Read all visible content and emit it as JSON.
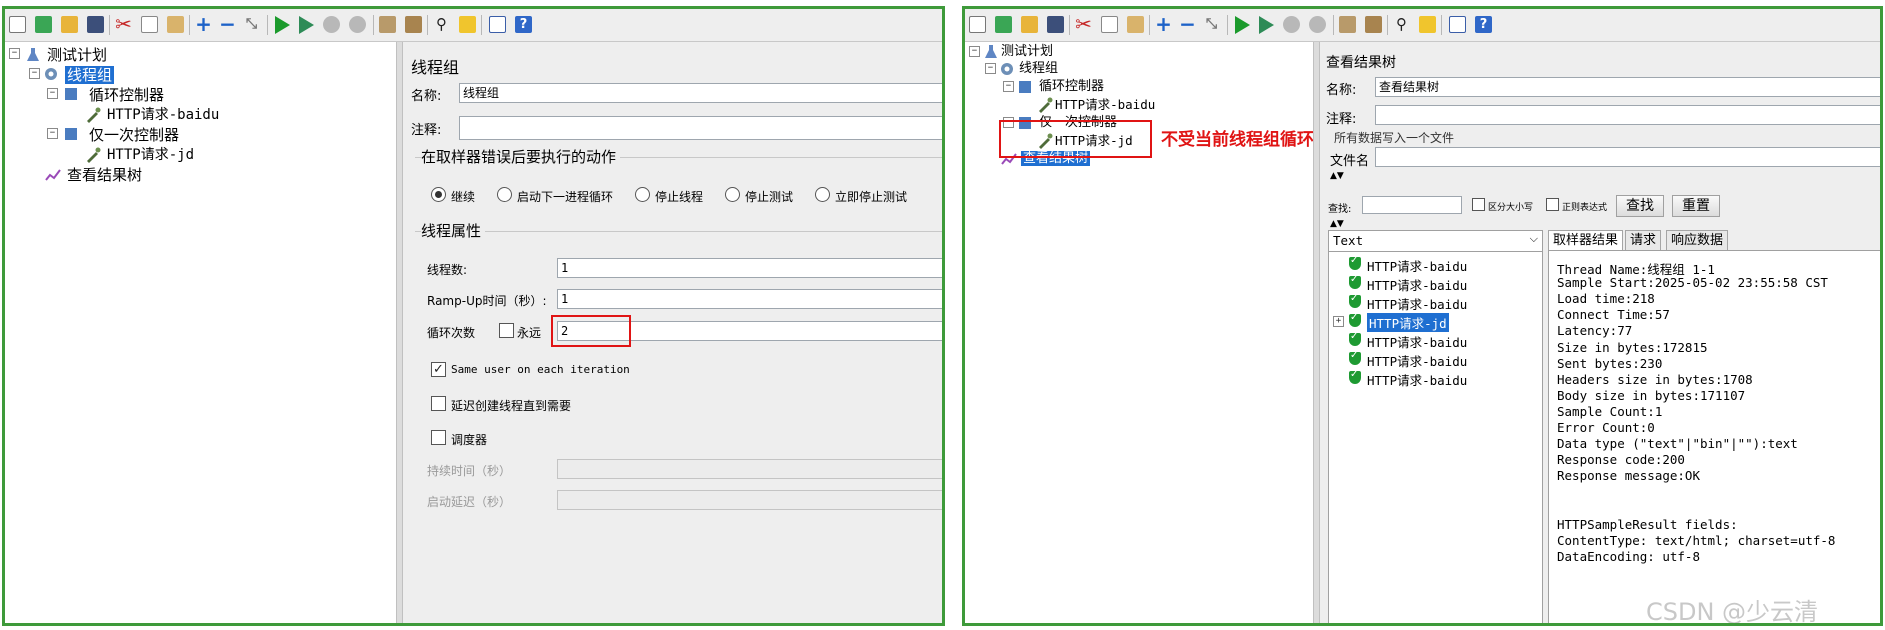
{
  "left": {
    "tree": {
      "root": "测试计划",
      "thread_group": "线程组",
      "loop_controller": "循环控制器",
      "http_baidu": "HTTP请求-baidu",
      "once_controller": "仅一次控制器",
      "http_jd": "HTTP请求-jd",
      "results_tree": "查看结果树"
    },
    "form": {
      "title": "线程组",
      "name_label": "名称:",
      "name_value": "线程组",
      "comment_label": "注释:",
      "error_section": "在取样器错误后要执行的动作",
      "radio_continue": "继续",
      "radio_next_loop": "启动下一进程循环",
      "radio_stop_thread": "停止线程",
      "radio_stop_test": "停止测试",
      "radio_stop_now": "立即停止测试",
      "props_section": "线程属性",
      "threads_label": "线程数:",
      "threads_value": "1",
      "rampup_label": "Ramp-Up时间（秒）:",
      "rampup_value": "1",
      "loop_label": "循环次数",
      "forever_label": "永远",
      "loop_value": "2",
      "same_user_label": "Same user on each iteration",
      "delay_create_label": "延迟创建线程直到需要",
      "scheduler_label": "调度器",
      "duration_label": "持续时间（秒）",
      "startup_delay_label": "启动延迟（秒）"
    }
  },
  "right": {
    "tree": {
      "root": "测试计划",
      "thread_group": "线程组",
      "loop_controller": "循环控制器",
      "http_baidu": "HTTP请求-baidu",
      "once_controller": "仅一次控制器",
      "http_jd": "HTTP请求-jd",
      "results_tree": "查看结果树"
    },
    "annotation": "不受当前线程组循环次数影响",
    "form": {
      "title": "查看结果树",
      "name_label": "名称:",
      "name_value": "查看结果树",
      "comment_label": "注释:",
      "all_data_label": "所有数据写入一个文件",
      "filename_label": "文件名",
      "search_label": "查找:",
      "case_label": "区分大小写",
      "regex_label": "正则表达式",
      "search_button": "查找",
      "reset_button": "重置",
      "render_select": "Text",
      "results": [
        "HTTP请求-baidu",
        "HTTP请求-baidu",
        "HTTP请求-baidu",
        "HTTP请求-jd",
        "HTTP请求-baidu",
        "HTTP请求-baidu",
        "HTTP请求-baidu"
      ],
      "tabs": [
        "取样器结果",
        "请求",
        "响应数据"
      ],
      "sampler_lines": [
        "Thread Name:线程组 1-1",
        "Sample Start:2025-05-02 23:55:58 CST",
        "Load time:218",
        "Connect Time:57",
        "Latency:77",
        "Size in bytes:172815",
        "Sent bytes:230",
        "Headers size in bytes:1708",
        "Body size in bytes:171107",
        "Sample Count:1",
        "Error Count:0",
        "Data type (\"text\"|\"bin\"|\"\"):text",
        "Response code:200",
        "Response message:OK",
        "",
        "",
        "HTTPSampleResult fields:",
        "ContentType: text/html; charset=utf-8",
        "DataEncoding: utf-8"
      ]
    }
  },
  "watermark": "CSDN @少云清",
  "colors": {
    "selection": "#1f6fd1",
    "panel_border": "#3e9a3a",
    "highlight": "#e01414"
  }
}
